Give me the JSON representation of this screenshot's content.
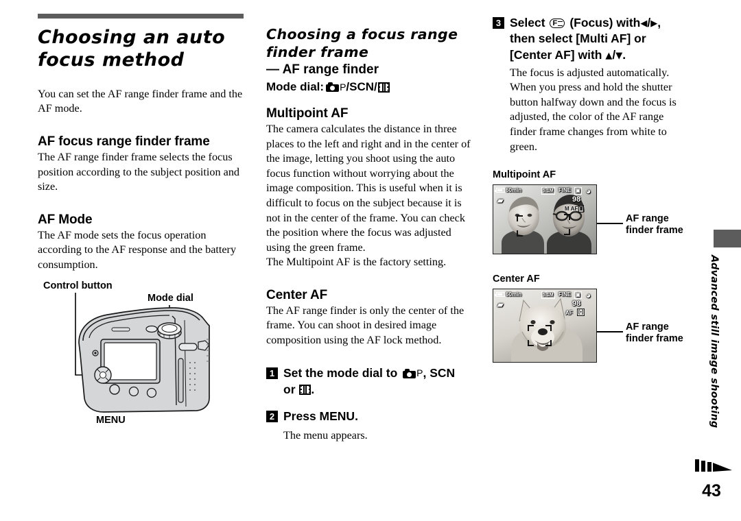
{
  "page": {
    "number": "43",
    "side_tab_text": "Advanced still image shooting",
    "forward_icon": "fast-forward-icon"
  },
  "col1": {
    "chapter_title": "Choosing an auto focus method",
    "intro": "You can set the AF range finder frame and the AF mode.",
    "sub1_head": "AF focus range finder frame",
    "sub1_body": "The AF range finder frame selects the focus position according to the subject position and size.",
    "sub2_head": "AF Mode",
    "sub2_body": "The AF mode sets the focus operation according to the AF response and the battery consumption.",
    "illustration": {
      "name": "camera-rear-illustration",
      "callout_control_button": "Control button",
      "callout_mode_dial": "Mode dial",
      "callout_menu": "MENU"
    }
  },
  "col2": {
    "section_title": "Choosing a focus range finder frame",
    "dash_head": "— AF range finder",
    "mode_dial_label": "Mode dial:",
    "mode_dial_p": "P",
    "mode_dial_scn": "/SCN/",
    "mode_dial_camera_icon": "camera-icon",
    "mode_dial_movie_icon": "movie-film-icon",
    "multipoint_head": "Multipoint AF",
    "multipoint_body": "The camera calculates the distance in three places to the left and right and in the center of the image, letting you shoot using the auto focus function without worrying about the image composition. This is useful when it is difficult to focus on the subject because it is not in the center of the frame. You can check the position where the focus was adjusted using the green frame.",
    "multipoint_body2": "The Multipoint AF is the factory setting.",
    "center_head": "Center AF",
    "center_body": "The AF range finder is only the center of the frame. You can shoot in desired image composition using the AF lock method.",
    "step1": {
      "num": "1",
      "text_a": "Set the mode dial to",
      "text_p": "P",
      "text_b": ", SCN",
      "text_c": "or",
      "text_d": "."
    },
    "step2": {
      "num": "2",
      "text": "Press MENU.",
      "note": "The menu appears."
    }
  },
  "col3": {
    "step3": {
      "num": "3",
      "line1_a": "Select",
      "focus_icon": "focus-icon",
      "line1_b": "(Focus) with",
      "line1_left": "◀",
      "line1_slash": "/",
      "line1_right": "▶",
      "line1_c": ",",
      "line2": "then select [Multi AF] or",
      "line3_a": "[Center AF] with",
      "line3_up": "▲",
      "line3_slash": "/",
      "line3_down": "▼",
      "line3_b": ".",
      "body": "The focus is adjusted automatically. When you press and hold the shutter button halfway down and the focus is adjusted, the color of the AF range finder frame changes from white to green."
    },
    "sample1": {
      "head": "Multipoint AF",
      "callout": "AF range finder frame",
      "osd": {
        "battery": "60min",
        "size": "5.1M",
        "quality": "FINE",
        "counter": "98",
        "af_mode": "M AF"
      }
    },
    "sample2": {
      "head": "Center AF",
      "callout": "AF range finder frame",
      "osd": {
        "battery": "60min",
        "size": "5.1M",
        "quality": "FINE",
        "counter": "98",
        "af_mode": "AF"
      }
    }
  }
}
